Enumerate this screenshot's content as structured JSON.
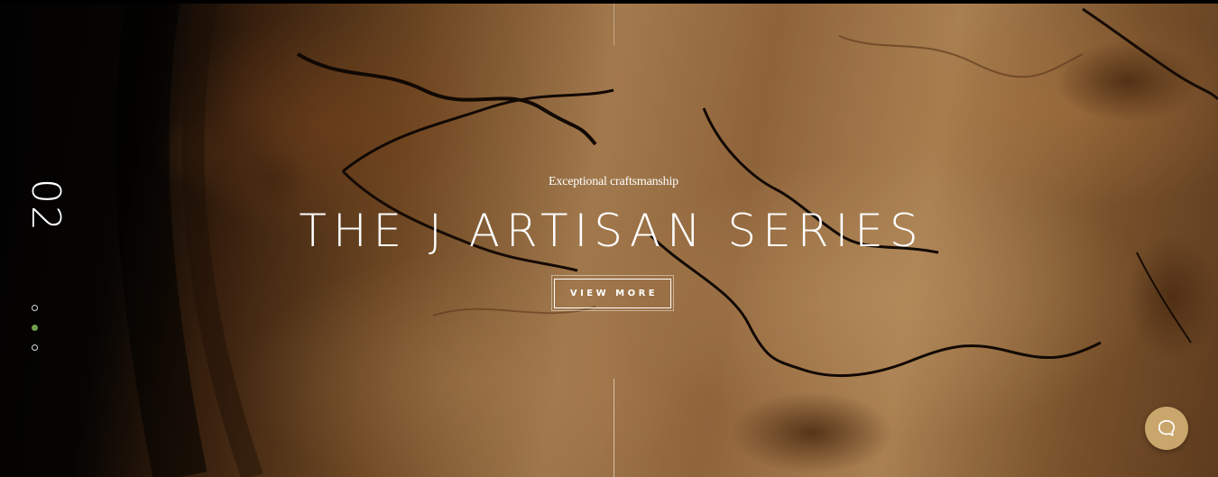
{
  "slider": {
    "slide_number": "02",
    "tagline": "Exceptional craftsmanship",
    "headline": "THE J ARTISAN SERIES",
    "cta_label": "VIEW MORE",
    "active_slide": 2,
    "total_slides": 3
  },
  "colors": {
    "active_dot": "#6ea04a",
    "chat_button": "#c9a66b",
    "text": "#ffffff"
  },
  "icons": {
    "chat": "chat-bubble-icon"
  }
}
